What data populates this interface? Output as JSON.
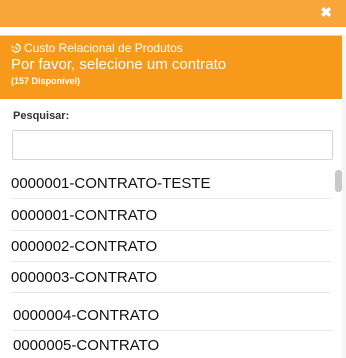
{
  "dialog": {
    "close_glyph": "✖",
    "subtitle": "Custo Relacional de Produtos",
    "title": "Por favor, selecione um contrato",
    "available": "(157 Disponível)",
    "accent": "#f79a1c"
  },
  "search": {
    "label": "Pesquisar:",
    "value": "",
    "placeholder": ""
  },
  "contracts": [
    "0000001-CONTRATO-TESTE",
    "0000001-CONTRATO",
    "0000002-CONTRATO",
    "0000003-CONTRATO",
    "0000004-CONTRATO",
    "0000005-CONTRATO"
  ]
}
